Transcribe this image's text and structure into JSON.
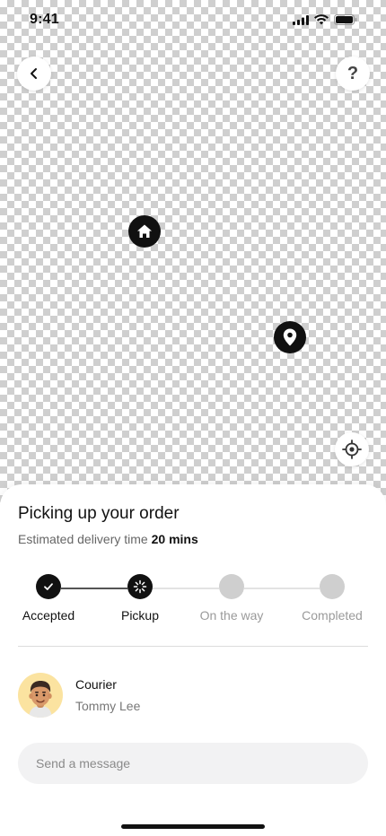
{
  "status_bar": {
    "time": "9:41",
    "icons": [
      "cellular-signal-icon",
      "wifi-icon",
      "battery-icon"
    ]
  },
  "map": {
    "back_icon": "chevron-left-icon",
    "help_label": "?",
    "locate_icon": "crosshair-icon",
    "markers": [
      "home-icon",
      "location-pin-icon"
    ]
  },
  "order": {
    "title": "Picking up your order",
    "eta_prefix": "Estimated delivery time",
    "eta_value": "20 mins"
  },
  "stepper": {
    "steps": [
      {
        "label": "Accepted",
        "state": "done"
      },
      {
        "label": "Pickup",
        "state": "current"
      },
      {
        "label": "On the way",
        "state": "pending"
      },
      {
        "label": "Completed",
        "state": "pending"
      }
    ]
  },
  "courier": {
    "role": "Courier",
    "name": "Tommy Lee"
  },
  "message": {
    "placeholder": "Send a message"
  },
  "colors": {
    "accent": "#111111",
    "pending": "#cfcfcf",
    "avatar_bg": "#fbe3a0"
  }
}
